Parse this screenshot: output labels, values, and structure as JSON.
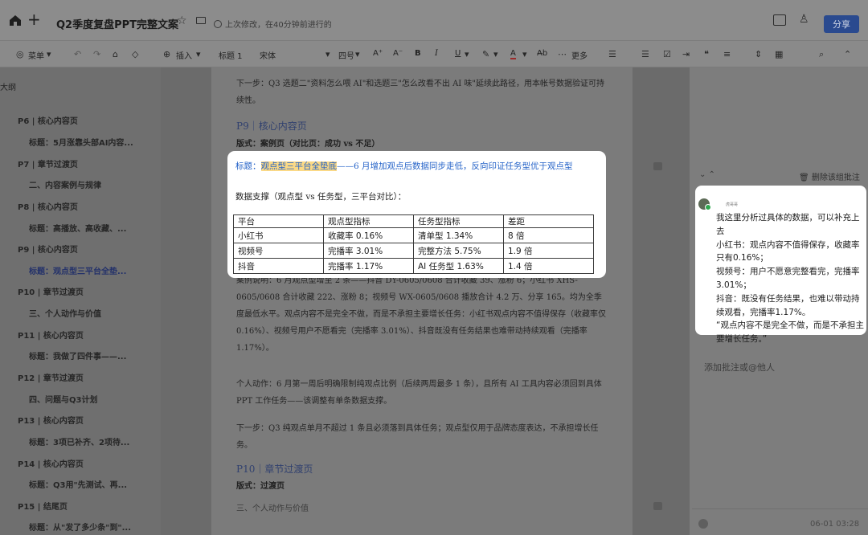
{
  "topbar": {
    "title": "Q2季度复盘PPT完整文案",
    "status": "上次修改，在40分钟前进行的",
    "share_label": "分享"
  },
  "toolbar": {
    "menu": "菜单",
    "insert": "插入",
    "style": "标题 1",
    "font": "宋体",
    "size": "四号",
    "more": "更多"
  },
  "outline": {
    "title": "大纲",
    "items": [
      "P6 | 核心内容页",
      "标题：5月涨靠头部AI内容...",
      "P7 | 章节过渡页",
      "二、内容案例与规律",
      "P8 | 核心内容页",
      "标题：高播放、高收藏、...",
      "P9 | 核心内容页",
      "标题：观点型三平台全垫...",
      "P10 | 章节过渡页",
      "三、个人动作与价值",
      "P11 | 核心内容页",
      "标题：我做了四件事——...",
      "P12 | 章节过渡页",
      "四、问题与Q3计划",
      "P13 | 核心内容页",
      "标题：3项已补齐、2项待...",
      "P14 | 核心内容页",
      "标题：Q3用\"先测试、再...",
      "P15 | 结尾页",
      "标题：从\"发了多少条\"到\"..."
    ]
  },
  "doc": {
    "p1": "下一步：Q3 选题二\"资料怎么喂 AI\"和选题三\"怎么改看不出 AI 味\"延续此路径，用本帐号数据验证可持续性。",
    "p9_heading": "P9｜核心内容页",
    "p9_format": "版式：案例页（对比页：成功 vs 不足）",
    "popup_title_hl": "观点型三平台全垫底",
    "popup_title_prefix": "标题：",
    "popup_title_rest": "——6 月增加观点后数据同步走低，反向印证任务型优于观点型",
    "popup_support": "数据支撑（观点型 vs 任务型，三平台对比）：",
    "table": [
      [
        "平台",
        "观点型指标",
        "任务型指标",
        "差距"
      ],
      [
        "小红书",
        "收藏率 0.16%",
        "清单型 1.34%",
        "8 倍"
      ],
      [
        "视频号",
        "完播率 3.01%",
        "完整方法 5.75%",
        "1.9 倍"
      ],
      [
        "抖音",
        "完播率 1.17%",
        "AI 任务型 1.63%",
        "1.4 倍"
      ]
    ],
    "p_case": "案例说明：6 月观点型增至 2 条——抖音 DY-0605/0608 合计收藏 39、涨粉 6；小红书 XHS-0605/0608 合计收藏 222、涨粉 8；视频号 WX-0605/0608 播放合计 4.2 万、分享 165。均为全季度最低水平。观点内容不是完全不做，而是不承担主要增长任务：小红书观点内容不值得保存（收藏率仅 0.16%）、视频号用户不愿看完（完播率 3.01%）、抖音既没有任务结果也难带动持续观看（完播率 1.17%）。",
    "p_action": "个人动作：6 月第一周后明确限制纯观点比例（后续两周最多 1 条），且所有 AI 工具内容必须回到具体 PPT 工作任务——该调整有单条数据支撑。",
    "p_next": "下一步：Q3 纯观点单月不超过 1 条且必须落到具体任务；观点型仅用于品牌态度表达，不承担增长任务。",
    "p10_heading": "P10｜章节过渡页",
    "p10_format": "版式：过渡页",
    "p10_section": "三、个人动作与价值"
  },
  "comments": {
    "delete_resolved": "删除该组批注",
    "author": "虎哥哥",
    "text": "我这里分析过具体的数据，可以补充上去\n小红书：观点内容不值得保存，收藏率只有0.16%；\n视频号：用户不愿意完整看完，完播率3.01%；\n抖音：既没有任务结果，也难以带动持续观看，完播率1.17%。\n“观点内容不是完全不做，而是不承担主要增长任务。”",
    "add_placeholder": "添加批注或@他人",
    "footer_time": "06-01 03:28"
  },
  "colors": {
    "accent_blue": "#2563c8",
    "highlight": "#fbd986",
    "share_button": "#2a4a8f",
    "overlay_gray": "#6b6b6b"
  }
}
